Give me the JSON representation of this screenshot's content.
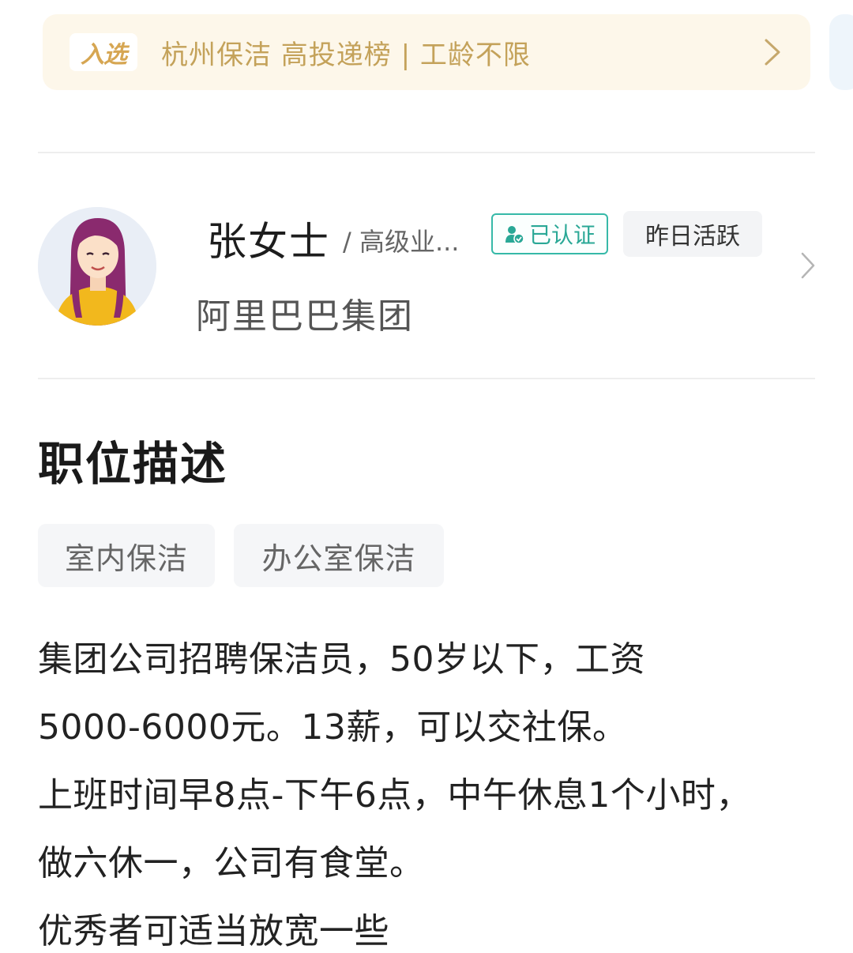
{
  "banner": {
    "badge": "入选",
    "text": "杭州保洁 高投递榜 | 工龄不限"
  },
  "recruiter": {
    "name": "张女士",
    "role": "/ 高级业...",
    "verified_label": "已认证",
    "active_label": "昨日活跃",
    "company": "阿里巴巴集团"
  },
  "job": {
    "section_title": "职位描述",
    "tags": [
      "室内保洁",
      "办公室保洁"
    ],
    "description_lines": [
      "集团公司招聘保洁员，50岁以下，工资",
      "5000-6000元。13薪，可以交社保。",
      "上班时间早8点-下午6点，中午休息1个小时，",
      "做六休一，公司有食堂。",
      "优秀者可适当放宽一些"
    ]
  },
  "colors": {
    "banner_bg": "#fdf7ea",
    "banner_text": "#c4a25a",
    "verified": "#2aa896"
  },
  "icons": {
    "banner_arrow": "chevron-right-icon",
    "verified": "verified-user-icon",
    "recruiter_arrow": "chevron-right-icon"
  }
}
